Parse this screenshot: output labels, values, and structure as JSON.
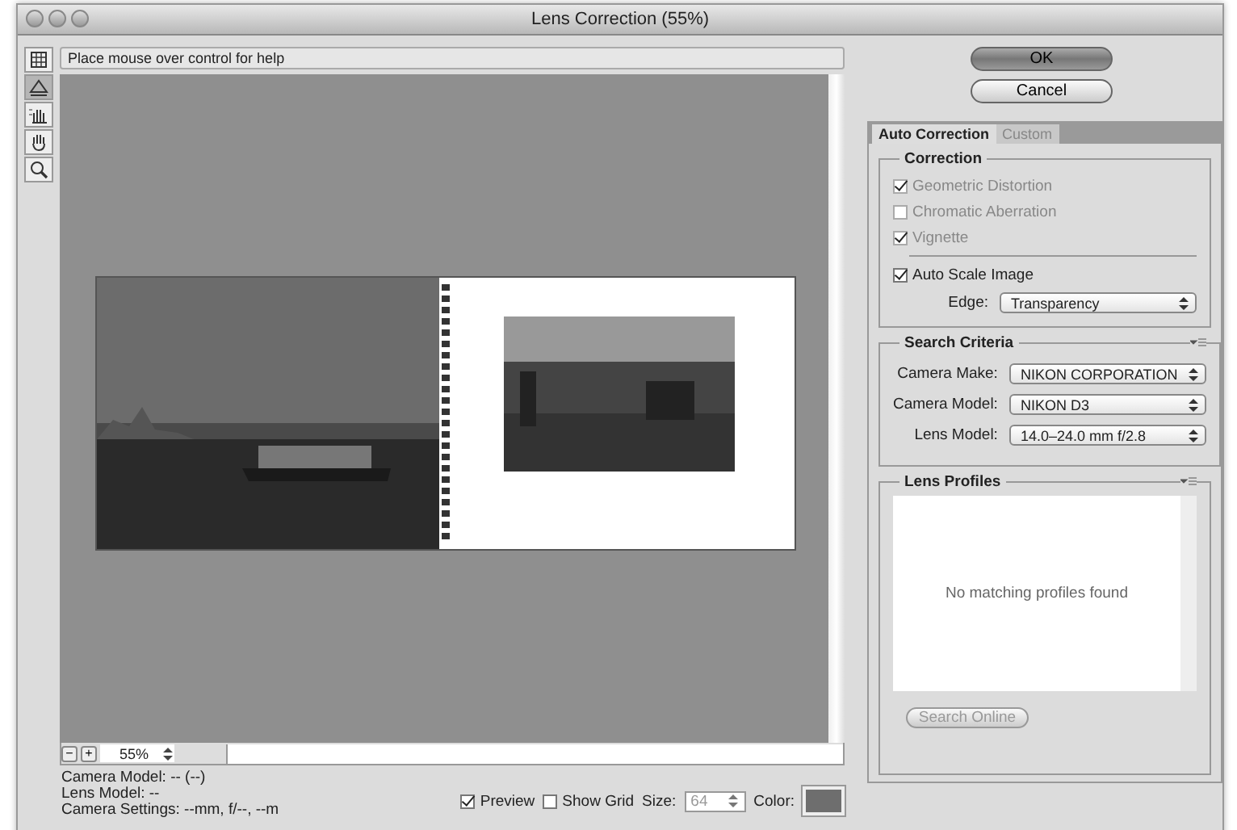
{
  "window": {
    "title": "Lens Correction (55%)"
  },
  "tools": [
    {
      "kind": "remove",
      "selected": false
    },
    {
      "kind": "straighten",
      "selected": true
    },
    {
      "kind": "grid",
      "selected": false
    },
    {
      "kind": "hand",
      "selected": false
    },
    {
      "kind": "zoom",
      "selected": false
    }
  ],
  "help_text": "Place mouse over control for help",
  "zoom": {
    "minus": "−",
    "plus": "+",
    "value": "55%"
  },
  "info": [
    "Camera Model: -- (--)",
    "Lens Model: --",
    "Camera Settings: --mm, f/--, --m"
  ],
  "options": {
    "preview": {
      "label": "Preview",
      "checked": true
    },
    "show_grid": {
      "label": "Show Grid",
      "checked": false
    },
    "size": {
      "label": "Size:",
      "value": "64",
      "disabled": true
    },
    "color": {
      "label": "Color:",
      "color": "#6e6e6e"
    }
  },
  "buttons": [
    {
      "label": "OK",
      "default": true
    },
    {
      "label": "Cancel",
      "default": false
    }
  ],
  "tabs": [
    {
      "label": "Auto Correction",
      "selected": true
    },
    {
      "label": "Custom",
      "selected": false
    }
  ],
  "correction": {
    "title": "Correction",
    "items": [
      {
        "label": "Geometric Distortion",
        "checked": true,
        "disabled": true
      },
      {
        "label": "Chromatic Aberration",
        "checked": false,
        "disabled": true
      },
      {
        "label": "Vignette",
        "checked": true,
        "disabled": true
      }
    ],
    "auto_scale": {
      "label": "Auto Scale Image",
      "checked": true
    },
    "edge": {
      "label": "Edge:",
      "value": "Transparency"
    }
  },
  "search_criteria": {
    "title": "Search Criteria",
    "fields": [
      {
        "label": "Camera Make:",
        "value": "NIKON CORPORATION"
      },
      {
        "label": "Camera Model:",
        "value": "NIKON D3"
      },
      {
        "label": "Lens Model:",
        "value": "14.0–24.0 mm f/2.8"
      }
    ]
  },
  "lens_profiles": {
    "title": "Lens Profiles",
    "empty_message": "No matching profiles found",
    "button": {
      "label": "Search Online",
      "disabled": true
    }
  }
}
